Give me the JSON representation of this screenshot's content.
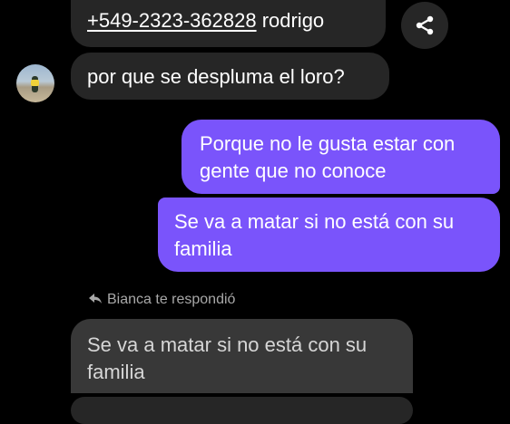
{
  "messages": {
    "first": {
      "phone": "+549-2323-362828",
      "name": "rodrigo"
    },
    "question": "por que se desplumа el loro?",
    "answer1": "Porque no le gusta estar con gente que no conoce",
    "answer2": "Se va a matar si no está con su familia",
    "reply_label": "Bianca te respondió",
    "quoted": "Se va a matar si no está con su familia"
  },
  "icons": {
    "share": "share-icon",
    "reply": "reply-arrow-icon"
  },
  "colors": {
    "background": "#000000",
    "incoming_bubble": "#262626",
    "outgoing_bubble": "#7a54fb",
    "quoted_bubble": "#383838",
    "secondary_text": "#a8a8a8"
  }
}
